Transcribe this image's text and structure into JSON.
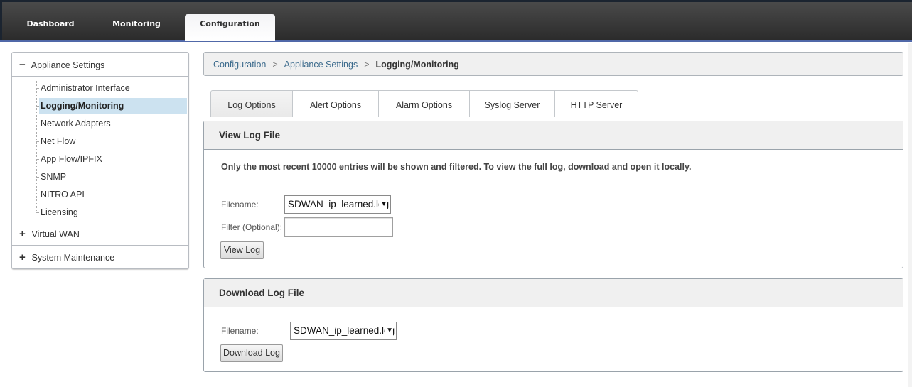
{
  "topnav": {
    "tabs": [
      {
        "label": "Dashboard",
        "active": false
      },
      {
        "label": "Monitoring",
        "active": false
      },
      {
        "label": "Configuration",
        "active": true
      }
    ]
  },
  "sidebar": {
    "groups": [
      {
        "label": "Appliance Settings",
        "expanded": true,
        "sign": "−",
        "items": [
          {
            "label": "Administrator Interface",
            "active": false
          },
          {
            "label": "Logging/Monitoring",
            "active": true
          },
          {
            "label": "Network Adapters",
            "active": false
          },
          {
            "label": "Net Flow",
            "active": false
          },
          {
            "label": "App Flow/IPFIX",
            "active": false
          },
          {
            "label": "SNMP",
            "active": false
          },
          {
            "label": "NITRO API",
            "active": false
          },
          {
            "label": "Licensing",
            "active": false
          }
        ]
      },
      {
        "label": "Virtual WAN",
        "expanded": false,
        "sign": "+"
      },
      {
        "label": "System Maintenance",
        "expanded": false,
        "sign": "+"
      }
    ]
  },
  "breadcrumb": {
    "items": [
      "Configuration",
      "Appliance Settings"
    ],
    "separator": ">",
    "current": "Logging/Monitoring"
  },
  "tabs": [
    {
      "label": "Log Options",
      "active": true
    },
    {
      "label": "Alert Options",
      "active": false
    },
    {
      "label": "Alarm Options",
      "active": false
    },
    {
      "label": "Syslog Server",
      "active": false
    },
    {
      "label": "HTTP Server",
      "active": false
    }
  ],
  "view_log": {
    "title": "View Log File",
    "notice": "Only the most recent 10000 entries will be shown and filtered. To view the full log, download and open it locally.",
    "filename_label": "Filename:",
    "filename_value": "SDWAN_ip_learned.log",
    "filter_label": "Filter (Optional):",
    "filter_value": "",
    "button": "View Log"
  },
  "download_log": {
    "title": "Download Log File",
    "filename_label": "Filename:",
    "filename_value": "SDWAN_ip_learned.log",
    "button": "Download Log"
  },
  "icons": {
    "dropdown_caret": "▼",
    "collapse": "−",
    "expand": "+"
  }
}
